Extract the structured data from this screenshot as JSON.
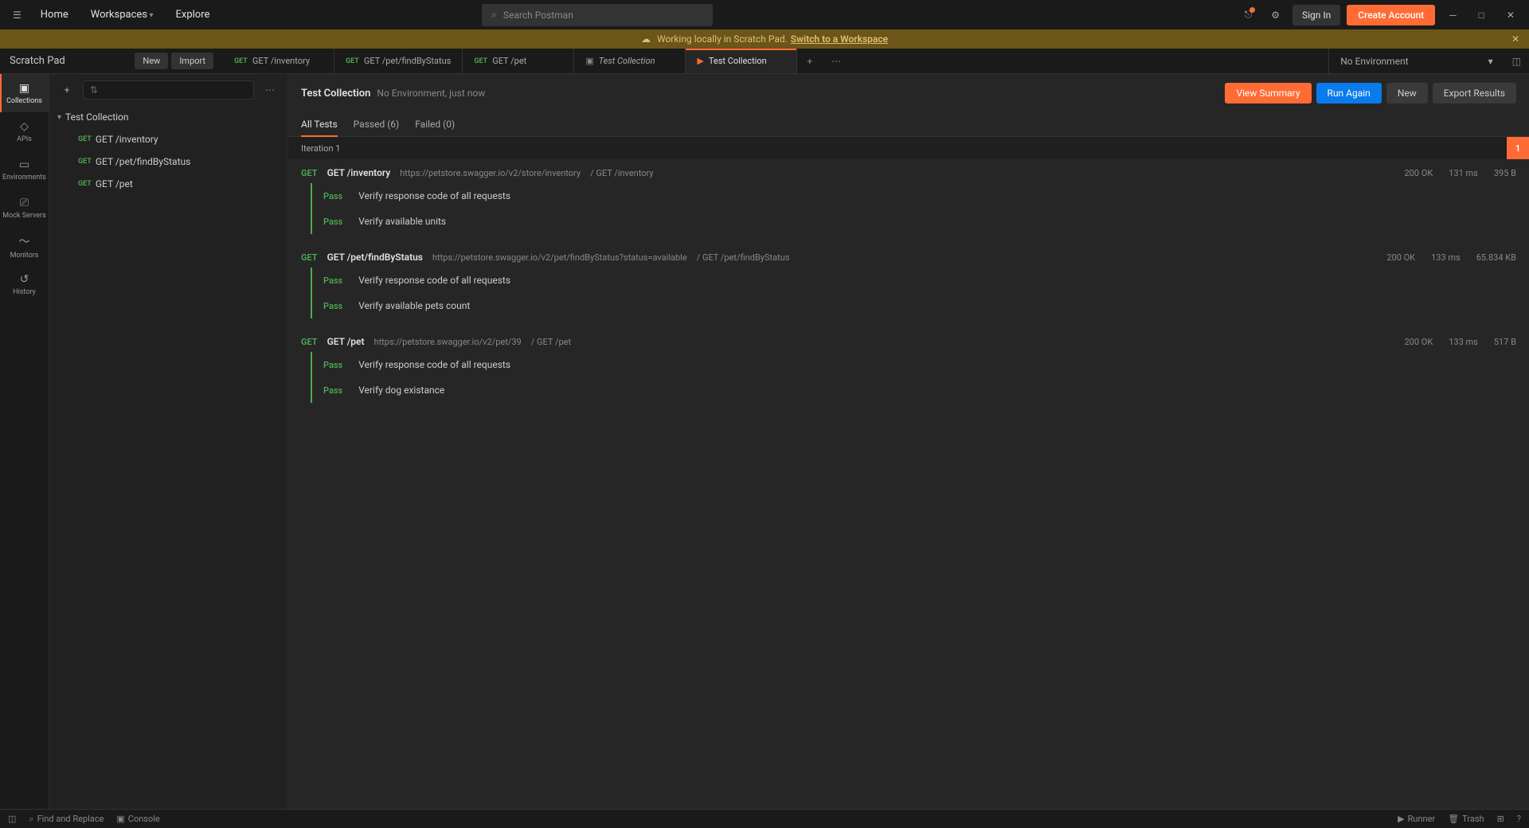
{
  "titlebar": {
    "home": "Home",
    "workspaces": "Workspaces",
    "explore": "Explore",
    "search_placeholder": "Search Postman",
    "signin": "Sign In",
    "create": "Create Account"
  },
  "banner": {
    "text": "Working locally in Scratch Pad.",
    "link": "Switch to a Workspace"
  },
  "workspace": {
    "label": "Scratch Pad",
    "new": "New",
    "import": "Import"
  },
  "tabs": [
    {
      "method": "GET",
      "label": "GET /inventory"
    },
    {
      "method": "GET",
      "label": "GET /pet/findByStatus"
    },
    {
      "method": "GET",
      "label": "GET /pet"
    },
    {
      "icon": "collection",
      "label": "Test Collection",
      "italic": true
    },
    {
      "icon": "play",
      "label": "Test Collection",
      "active": true
    }
  ],
  "env": {
    "selected": "No Environment"
  },
  "sidebar": [
    {
      "label": "Collections",
      "active": true
    },
    {
      "label": "APIs"
    },
    {
      "label": "Environments"
    },
    {
      "label": "Mock Servers"
    },
    {
      "label": "Monitors"
    },
    {
      "label": "History"
    }
  ],
  "tree": {
    "root": "Test Collection",
    "items": [
      {
        "method": "GET",
        "name": "GET /inventory"
      },
      {
        "method": "GET",
        "name": "GET /pet/findByStatus"
      },
      {
        "method": "GET",
        "name": "GET /pet"
      }
    ]
  },
  "content": {
    "title": "Test Collection",
    "subtitle": "No Environment, just now",
    "view_summary": "View Summary",
    "run_again": "Run Again",
    "new": "New",
    "export": "Export Results",
    "subtabs": {
      "all": "All Tests",
      "passed": "Passed (6)",
      "failed": "Failed (0)"
    },
    "iteration": "Iteration 1",
    "iter_num": "1"
  },
  "results": [
    {
      "method": "GET",
      "name": "GET /inventory",
      "url": "https://petstore.swagger.io/v2/store/inventory",
      "path": "/ GET /inventory",
      "status": "200 OK",
      "time": "131 ms",
      "size": "395 B",
      "tests": [
        {
          "status": "Pass",
          "desc": "Verify response code of all requests"
        },
        {
          "status": "Pass",
          "desc": "Verify available units"
        }
      ]
    },
    {
      "method": "GET",
      "name": "GET /pet/findByStatus",
      "url": "https://petstore.swagger.io/v2/pet/findByStatus?status=available",
      "path": "/ GET /pet/findByStatus",
      "status": "200 OK",
      "time": "133 ms",
      "size": "65.834 KB",
      "tests": [
        {
          "status": "Pass",
          "desc": "Verify response code of all requests"
        },
        {
          "status": "Pass",
          "desc": "Verify available pets count"
        }
      ]
    },
    {
      "method": "GET",
      "name": "GET /pet",
      "url": "https://petstore.swagger.io/v2/pet/39",
      "path": "/ GET /pet",
      "status": "200 OK",
      "time": "133 ms",
      "size": "517 B",
      "tests": [
        {
          "status": "Pass",
          "desc": "Verify response code of all requests"
        },
        {
          "status": "Pass",
          "desc": "Verify dog existance"
        }
      ]
    }
  ],
  "statusbar": {
    "find": "Find and Replace",
    "console": "Console",
    "runner": "Runner",
    "trash": "Trash"
  }
}
